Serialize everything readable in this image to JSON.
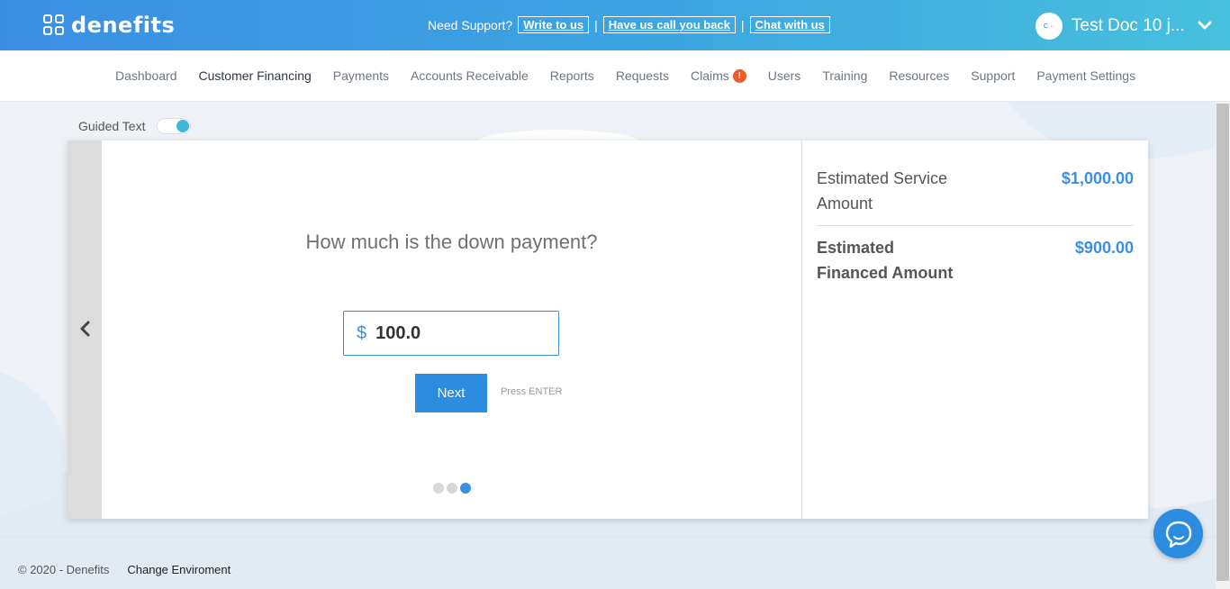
{
  "app": {
    "logo_text": "denefits"
  },
  "support": {
    "label": "Need Support?",
    "write_to_us": "Write to us",
    "call_back": "Have us call you back",
    "chat": "Chat with us",
    "separator": "|"
  },
  "user": {
    "name": "Test Doc 10 j...",
    "avatar_text": "C···"
  },
  "nav": {
    "items": [
      {
        "label": "Dashboard"
      },
      {
        "label": "Customer Financing"
      },
      {
        "label": "Payments"
      },
      {
        "label": "Accounts Receivable"
      },
      {
        "label": "Reports"
      },
      {
        "label": "Requests"
      },
      {
        "label": "Claims",
        "badge": "!"
      },
      {
        "label": "Users"
      },
      {
        "label": "Training"
      },
      {
        "label": "Resources"
      },
      {
        "label": "Support"
      },
      {
        "label": "Payment Settings"
      }
    ],
    "active": "Customer Financing"
  },
  "guided": {
    "label": "Guided Text",
    "enabled": true
  },
  "form": {
    "question": "How much is the down payment?",
    "currency_symbol": "$",
    "amount_value": "100.0",
    "next_label": "Next",
    "press_hint": "Press ENTER",
    "step_current": 3,
    "step_total": 3
  },
  "summary": {
    "service_label": "Estimated Service Amount",
    "service_value": "$1,000.00",
    "financed_label": "Estimated Financed Amount",
    "financed_value": "$900.00"
  },
  "footer": {
    "copyright": "© 2020 - Denefits",
    "change_env": "Change Enviroment"
  },
  "colors": {
    "accent": "#2c8de0",
    "header_start": "#3b8fe3",
    "header_end": "#47c0dd",
    "badge": "#ee5a24"
  },
  "icons": {
    "back": "chevron-left-icon",
    "user_menu": "chevron-down-icon",
    "chat": "chat-bubble-icon"
  }
}
